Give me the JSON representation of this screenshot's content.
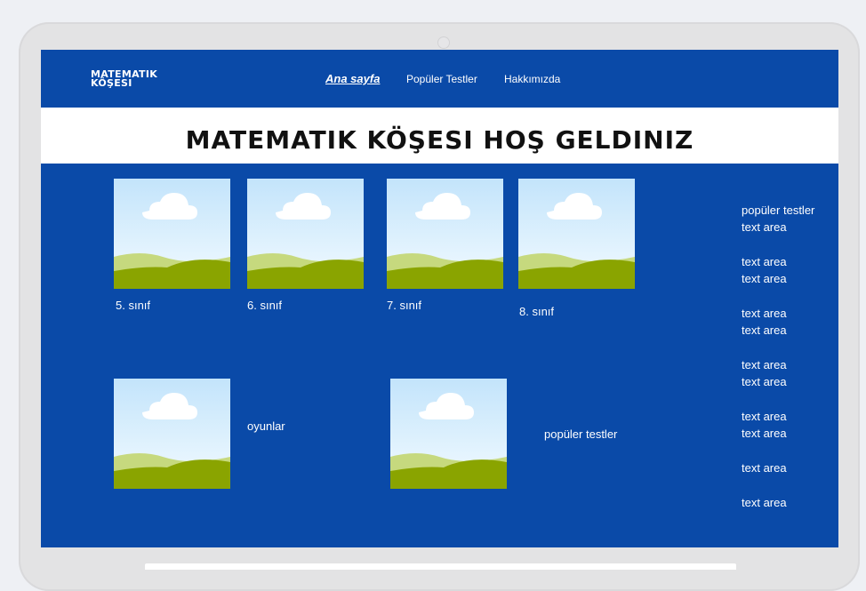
{
  "header": {
    "logo_line1": "MATEMATIK",
    "logo_line2": "KÖŞESI",
    "nav": [
      {
        "label": "Ana sayfa",
        "active": true
      },
      {
        "label": "Popüler Testler",
        "active": false
      },
      {
        "label": "Hakkımızda",
        "active": false
      }
    ]
  },
  "hero": {
    "title": "MATEMATIK KÖŞESI HOŞ GELDINIZ"
  },
  "grades": [
    {
      "label": "5. sınıf",
      "image_icon": "landscape-image-icon"
    },
    {
      "label": "6. sınıf",
      "image_icon": "landscape-image-icon"
    },
    {
      "label": "7. sınıf",
      "image_icon": "landscape-image-icon"
    },
    {
      "label": "8. sınıf",
      "image_icon": "landscape-image-icon"
    }
  ],
  "sections": [
    {
      "label": "oyunlar",
      "image_icon": "landscape-image-icon"
    },
    {
      "label": "popüler testler",
      "image_icon": "landscape-image-icon"
    }
  ],
  "sidebar": {
    "heading": "popüler testler",
    "items": [
      "text area",
      "text area",
      "text area",
      "text area",
      "text area",
      "text area",
      "text area",
      "text area",
      "text area",
      "text area",
      "text area"
    ]
  },
  "colors": {
    "brand_blue": "#0a4aa8",
    "white": "#ffffff",
    "sky_top": "#c3e4fb",
    "grass_light": "#c6d97e",
    "grass_dark": "#8aa400"
  }
}
